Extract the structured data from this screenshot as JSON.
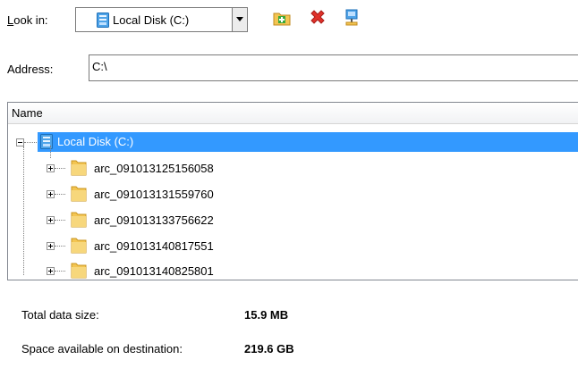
{
  "look_in": {
    "label_prefix": "",
    "label_mnemonic": "L",
    "label_rest": "ook in:",
    "selected": "Local Disk (C:)"
  },
  "toolbar": {
    "icons": [
      "new-folder-icon",
      "delete-icon",
      "network-drive-icon"
    ]
  },
  "address": {
    "label": "Address:",
    "value": "C:\\"
  },
  "tree": {
    "column_header": "Name",
    "root": {
      "label": "Local Disk (C:)",
      "icon": "drive-icon",
      "expanded": true,
      "selected": true
    },
    "children": [
      {
        "label": "arc_091013125156058",
        "icon": "folder-icon"
      },
      {
        "label": "arc_091013131559760",
        "icon": "folder-icon"
      },
      {
        "label": "arc_091013133756622",
        "icon": "folder-icon"
      },
      {
        "label": "arc_091013140817551",
        "icon": "folder-icon"
      },
      {
        "label": "arc_091013140825801",
        "icon": "folder-icon"
      }
    ]
  },
  "summary": {
    "total_label": "Total data size:",
    "total_value": "15.9 MB",
    "space_label": "Space available on destination:",
    "space_value": "219.6 GB"
  },
  "colors": {
    "selection": "#3399ff",
    "folder": "#f3c552",
    "drive": "#4ea3e8",
    "delete": "#e0312a"
  }
}
